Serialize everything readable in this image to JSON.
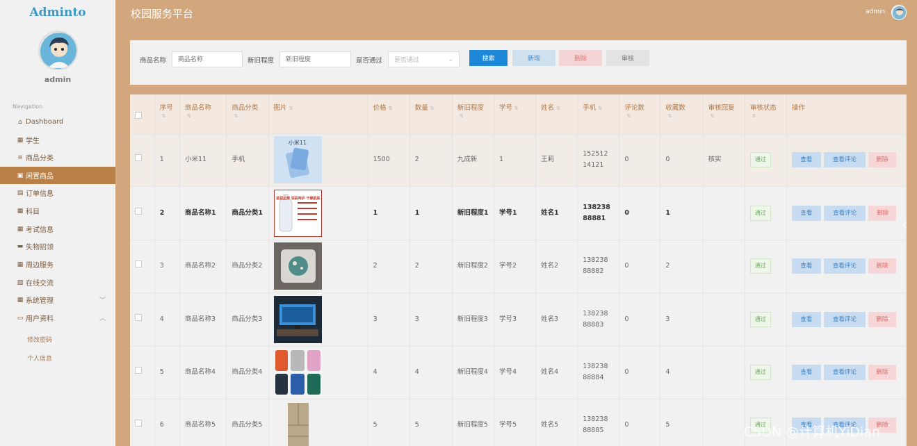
{
  "sidebar": {
    "logo": "Adminto",
    "username": "admin",
    "nav_title": "Navigation",
    "items": [
      {
        "label": "Dashboard",
        "icon": "home-icon"
      },
      {
        "label": "学生",
        "icon": "grid-icon"
      },
      {
        "label": "商品分类",
        "icon": "list-icon"
      },
      {
        "label": "闲置商品",
        "icon": "bag-icon"
      },
      {
        "label": "订单信息",
        "icon": "doc-icon"
      },
      {
        "label": "科目",
        "icon": "grid-icon"
      },
      {
        "label": "考试信息",
        "icon": "grid-icon"
      },
      {
        "label": "失物招领",
        "icon": "briefcase-icon"
      },
      {
        "label": "周边服务",
        "icon": "grid-icon"
      },
      {
        "label": "在线交流",
        "icon": "clipboard-icon"
      },
      {
        "label": "系统管理",
        "icon": "grid-icon"
      },
      {
        "label": "用户资料",
        "icon": "card-icon"
      }
    ],
    "sub_items": [
      "修改密码",
      "个人信息"
    ]
  },
  "header": {
    "title": "校园服务平台",
    "user": "admin"
  },
  "search": {
    "name_label": "商品名称",
    "name_placeholder": "商品名称",
    "condition_label": "新旧程度",
    "condition_placeholder": "新旧程度",
    "approved_label": "是否通过",
    "approved_placeholder": "是否通过",
    "buttons": {
      "search": "搜索",
      "add": "新增",
      "delete": "删除",
      "review": "审核"
    }
  },
  "table": {
    "headers": [
      "序号",
      "商品名称",
      "商品分类",
      "图片",
      "价格",
      "数量",
      "新旧程度",
      "学号",
      "姓名",
      "手机",
      "评论数",
      "收藏数",
      "审核回复",
      "审核状态",
      "操作"
    ],
    "actions": {
      "view": "查看",
      "comments": "查看评论",
      "delete": "删除"
    },
    "rows": [
      {
        "no": "1",
        "name": "小米11",
        "category": "手机",
        "price": "1500",
        "qty": "2",
        "condition": "九成新",
        "student_no": "1",
        "student_name": "王莉",
        "phone": "15251214121",
        "comments": "0",
        "favorites": "0",
        "reply": "核实",
        "status": "通过"
      },
      {
        "no": "2",
        "name": "商品名称1",
        "category": "商品分类1",
        "price": "1",
        "qty": "1",
        "condition": "新旧程度1",
        "student_no": "学号1",
        "student_name": "姓名1",
        "phone": "13823888881",
        "comments": "0",
        "favorites": "1",
        "reply": "",
        "status": "通过"
      },
      {
        "no": "3",
        "name": "商品名称2",
        "category": "商品分类2",
        "price": "2",
        "qty": "2",
        "condition": "新旧程度2",
        "student_no": "学号2",
        "student_name": "姓名2",
        "phone": "13823888882",
        "comments": "0",
        "favorites": "2",
        "reply": "",
        "status": "通过"
      },
      {
        "no": "4",
        "name": "商品名称3",
        "category": "商品分类3",
        "price": "3",
        "qty": "3",
        "condition": "新旧程度3",
        "student_no": "学号3",
        "student_name": "姓名3",
        "phone": "13823888883",
        "comments": "0",
        "favorites": "3",
        "reply": "",
        "status": "通过"
      },
      {
        "no": "5",
        "name": "商品名称4",
        "category": "商品分类4",
        "price": "4",
        "qty": "4",
        "condition": "新旧程度4",
        "student_no": "学号4",
        "student_name": "姓名4",
        "phone": "13823888884",
        "comments": "0",
        "favorites": "4",
        "reply": "",
        "status": "通过"
      },
      {
        "no": "6",
        "name": "商品名称5",
        "category": "商品分类5",
        "price": "5",
        "qty": "5",
        "condition": "新旧程度5",
        "student_no": "学号5",
        "student_name": "姓名5",
        "phone": "13823888885",
        "comments": "0",
        "favorites": "5",
        "reply": "",
        "status": "通过"
      }
    ],
    "images": {
      "thumb_1_text": "小米11",
      "thumb_2_text": "\"500ml 蓝润止痒 深层呵护 干燥肌肤 清爽滋养 清爽滋养\""
    }
  },
  "watermark": "CSDN @计算机YiDian",
  "colors": {
    "accent": "#b98147",
    "background": "#d2a77e",
    "search": "#1e88d8"
  }
}
